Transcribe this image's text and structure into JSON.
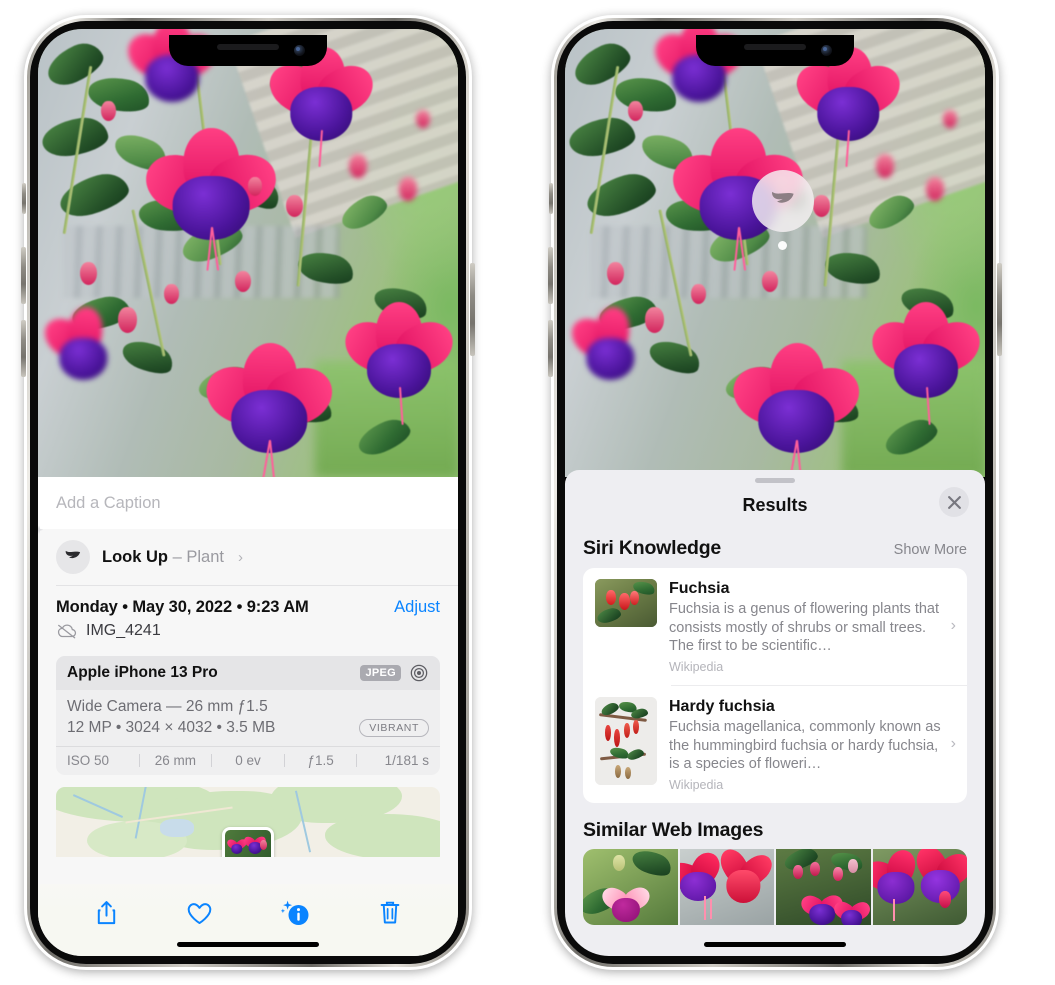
{
  "phones": {
    "left": {
      "screen_name": "photo-info-screen",
      "caption": {
        "placeholder": "Add a Caption",
        "value": ""
      },
      "lookup": {
        "label": "Look Up",
        "dash": "–",
        "subject": "Plant",
        "icon": "leaf-icon",
        "chevron": "›"
      },
      "meta": {
        "date": "Monday • May 30, 2022 • 9:23 AM",
        "adjust_label": "Adjust",
        "filename": "IMG_4241",
        "cloud_icon": "icloud-slash-icon"
      },
      "exif": {
        "device": "Apple iPhone 13 Pro",
        "format_badge": "JPEG",
        "aperture_icon": "camera-aperture-icon",
        "lens_line": "Wide Camera — 26 mm ƒ1.5",
        "size_line": "12 MP • 3024 × 4032 • 3.5 MB",
        "style_badge": "VIBRANT",
        "stats": [
          "ISO 50",
          "26 mm",
          "0 ev",
          "ƒ1.5",
          "1/181 s"
        ]
      },
      "toolbar": [
        {
          "name": "share-icon",
          "label": "Share"
        },
        {
          "name": "heart-icon",
          "label": "Favorite"
        },
        {
          "name": "info-sparkle-icon",
          "label": "Info"
        },
        {
          "name": "trash-icon",
          "label": "Delete"
        }
      ]
    },
    "right": {
      "screen_name": "visual-lookup-results-screen",
      "visual_lookup_badge": {
        "icon": "leaf-icon"
      },
      "sheet": {
        "title": "Results",
        "close_label": "×",
        "sections": [
          {
            "title": "Siri Knowledge",
            "action": "Show More",
            "cards": [
              {
                "title": "Fuchsia",
                "desc": "Fuchsia is a genus of flowering plants that consists mostly of shrubs or small trees. The first to be scientific…",
                "source": "Wikipedia",
                "chevron": "›"
              },
              {
                "title": "Hardy fuchsia",
                "desc": "Fuchsia magellanica, commonly known as the hummingbird fuchsia or hardy fuchsia, is a species of floweri…",
                "source": "Wikipedia",
                "chevron": "›"
              }
            ]
          },
          {
            "title": "Similar Web Images",
            "images": [
              "fuchsia-web-image-1",
              "fuchsia-web-image-2",
              "fuchsia-web-image-3",
              "fuchsia-web-image-4"
            ]
          }
        ]
      }
    }
  },
  "colors": {
    "accent_blue": "#0a84ff",
    "sheet_bg": "#eeeef2",
    "info_bg": "#f7f7f7",
    "card_bg": "#ffffff",
    "secondary_text": "#86868c"
  }
}
